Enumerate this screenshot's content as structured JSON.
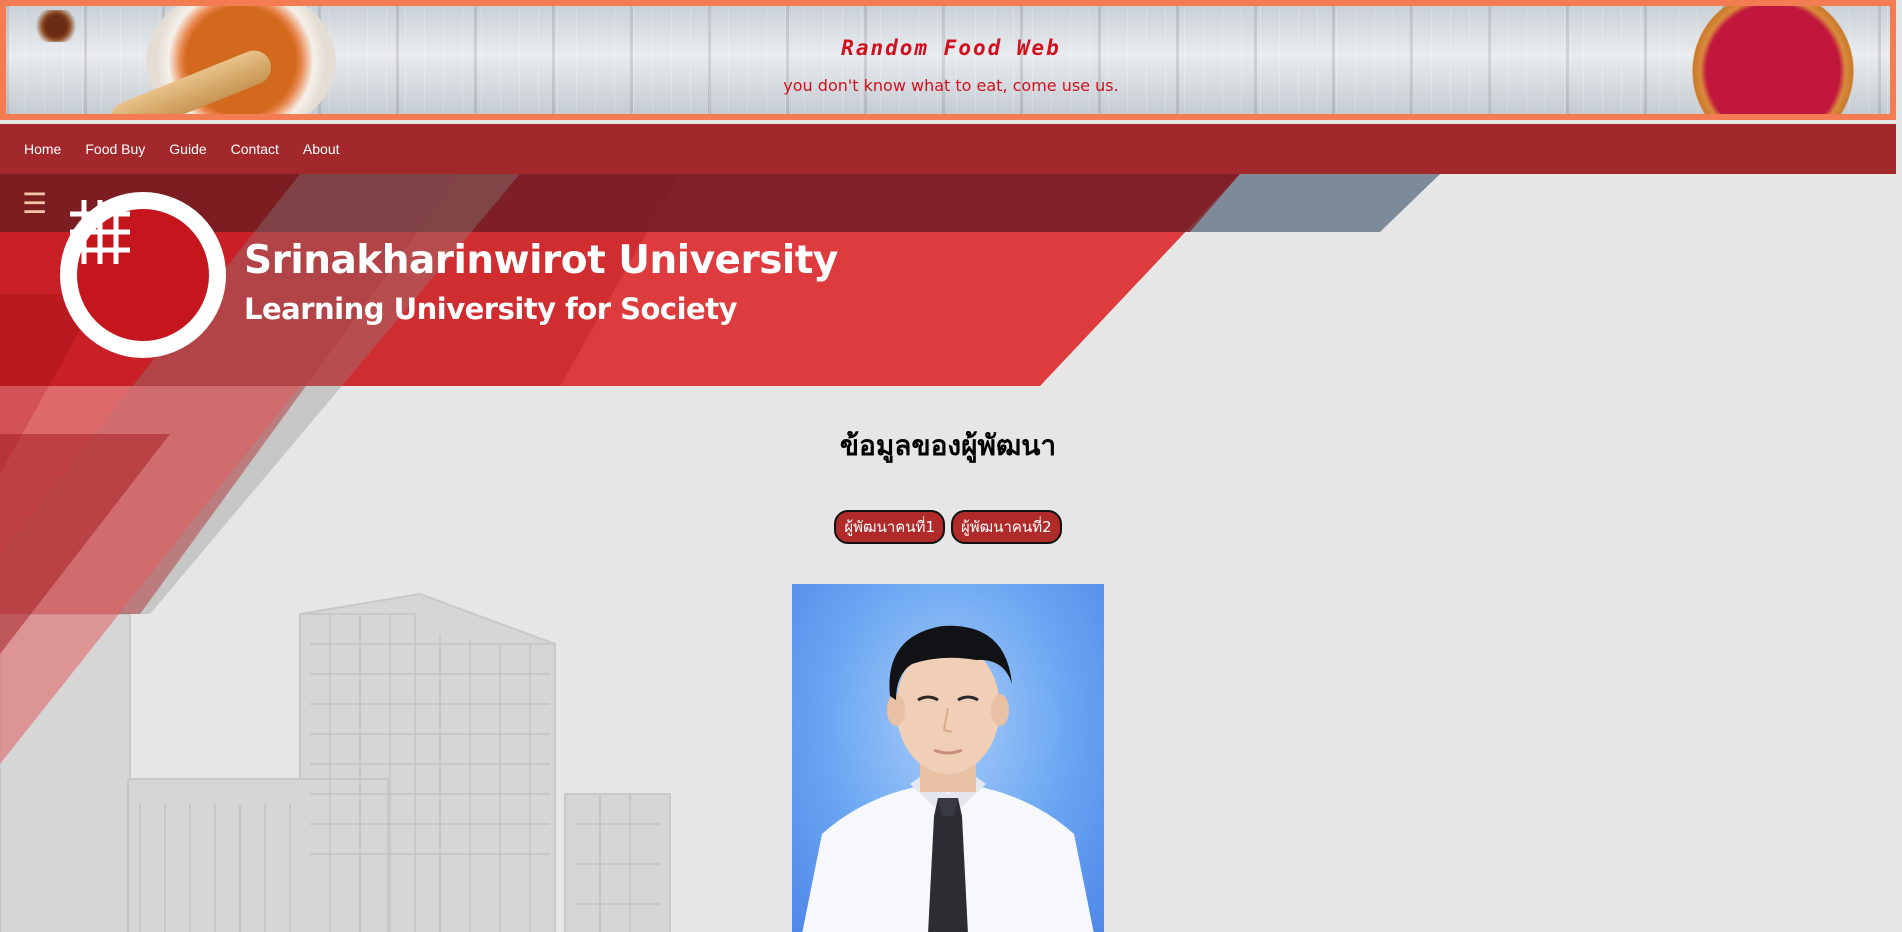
{
  "banner": {
    "title": "Random Food Web",
    "subtitle": "you don't know what to eat, come use us."
  },
  "nav": {
    "items": [
      "Home",
      "Food Buy",
      "Guide",
      "Contact",
      "About"
    ]
  },
  "hero": {
    "menu_icon": "hamburger-icon",
    "university_name": "Srinakharinwirot University",
    "university_tagline": "Learning University for Society"
  },
  "main": {
    "title": "ข้อมูลของผู้พัฒนา",
    "developer_buttons": [
      "ผู้พัฒนาคนที่1",
      "ผู้พัฒนาคนที่2"
    ]
  },
  "colors": {
    "banner_border": "#f47c52",
    "nav_background": "#a3282b",
    "brand_red": "#c4161c",
    "button_red": "#b02a2a",
    "page_background": "#e6e6e6"
  }
}
